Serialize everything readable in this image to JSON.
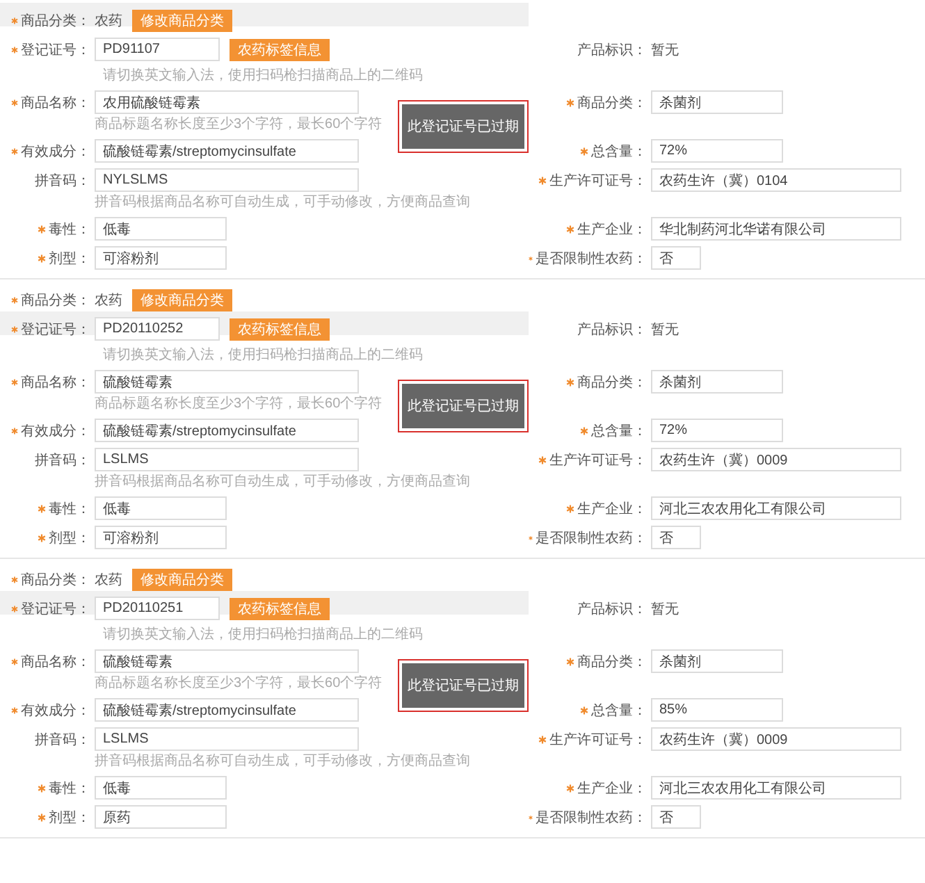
{
  "sections": [
    {
      "category": {
        "label": "商品分类：",
        "required": true,
        "value": "农药",
        "button": "修改商品分类",
        "shaded": true
      },
      "register": {
        "label": "登记证号：",
        "required": true,
        "value": "PD91107",
        "button": "农药标签信息",
        "hint": "请切换英文输入法，使用扫码枪扫描商品上的二维码",
        "shaded": false
      },
      "product_mark": {
        "label": "产品标识：",
        "value": "暂无"
      },
      "notice": "此登记证号已过期",
      "left_fields": [
        {
          "label": "商品名称：",
          "required": true,
          "value": "农用硫酸链霉素",
          "hint": "商品标题名称长度至少3个字符，最长60个字符",
          "kind": "long"
        },
        {
          "label": "有效成分：",
          "required": true,
          "value": "硫酸链霉素/streptomycinsulfate",
          "kind": "long"
        },
        {
          "label": "拼音码：",
          "required": false,
          "value": "NYLSLMS",
          "hint": "拼音码根据商品名称可自动生成，可手动修改，方便商品查询",
          "kind": "long"
        },
        {
          "label": "毒性：",
          "required": true,
          "value": "低毒",
          "kind": "short"
        },
        {
          "label": "剂型：",
          "required": true,
          "value": "可溶粉剂",
          "kind": "short"
        }
      ],
      "right_fields": [
        {
          "label": "商品分类：",
          "required": true,
          "value": "杀菌剂",
          "kind": "short"
        },
        {
          "label": "总含量：",
          "required": true,
          "value": "72%",
          "kind": "short"
        },
        {
          "label": "生产许可证号：",
          "required": true,
          "value": "农药生许（冀）0104",
          "kind": "long"
        },
        {
          "label": "生产企业：",
          "required": true,
          "value": "华北制药河北华诺有限公司",
          "kind": "long"
        },
        {
          "label": "是否限制性农药：",
          "required": true,
          "value": "否",
          "kind": "tiny"
        }
      ]
    },
    {
      "category": {
        "label": "商品分类：",
        "required": true,
        "value": "农药",
        "button": "修改商品分类",
        "shaded": false
      },
      "register": {
        "label": "登记证号：",
        "required": true,
        "value": "PD20110252",
        "button": "农药标签信息",
        "hint": "请切换英文输入法，使用扫码枪扫描商品上的二维码",
        "shaded": true
      },
      "product_mark": {
        "label": "产品标识：",
        "value": "暂无"
      },
      "notice": "此登记证号已过期",
      "left_fields": [
        {
          "label": "商品名称：",
          "required": true,
          "value": "硫酸链霉素",
          "hint": "商品标题名称长度至少3个字符，最长60个字符",
          "kind": "long"
        },
        {
          "label": "有效成分：",
          "required": true,
          "value": "硫酸链霉素/streptomycinsulfate",
          "kind": "long"
        },
        {
          "label": "拼音码：",
          "required": false,
          "value": "LSLMS",
          "hint": "拼音码根据商品名称可自动生成，可手动修改，方便商品查询",
          "kind": "long"
        },
        {
          "label": "毒性：",
          "required": true,
          "value": "低毒",
          "kind": "short"
        },
        {
          "label": "剂型：",
          "required": true,
          "value": "可溶粉剂",
          "kind": "short"
        }
      ],
      "right_fields": [
        {
          "label": "商品分类：",
          "required": true,
          "value": "杀菌剂",
          "kind": "short"
        },
        {
          "label": "总含量：",
          "required": true,
          "value": "72%",
          "kind": "short"
        },
        {
          "label": "生产许可证号：",
          "required": true,
          "value": "农药生许（冀）0009",
          "kind": "long"
        },
        {
          "label": "生产企业：",
          "required": true,
          "value": "河北三农农用化工有限公司",
          "kind": "long"
        },
        {
          "label": "是否限制性农药：",
          "required": true,
          "value": "否",
          "kind": "tiny"
        }
      ]
    },
    {
      "category": {
        "label": "商品分类：",
        "required": true,
        "value": "农药",
        "button": "修改商品分类",
        "shaded": false
      },
      "register": {
        "label": "登记证号：",
        "required": true,
        "value": "PD20110251",
        "button": "农药标签信息",
        "hint": "请切换英文输入法，使用扫码枪扫描商品上的二维码",
        "shaded": true
      },
      "product_mark": {
        "label": "产品标识：",
        "value": "暂无"
      },
      "notice": "此登记证号已过期",
      "left_fields": [
        {
          "label": "商品名称：",
          "required": true,
          "value": "硫酸链霉素",
          "hint": "商品标题名称长度至少3个字符，最长60个字符",
          "kind": "long"
        },
        {
          "label": "有效成分：",
          "required": true,
          "value": "硫酸链霉素/streptomycinsulfate",
          "kind": "long"
        },
        {
          "label": "拼音码：",
          "required": false,
          "value": "LSLMS",
          "hint": "拼音码根据商品名称可自动生成，可手动修改，方便商品查询",
          "kind": "long"
        },
        {
          "label": "毒性：",
          "required": true,
          "value": "低毒",
          "kind": "short"
        },
        {
          "label": "剂型：",
          "required": true,
          "value": "原药",
          "kind": "short"
        }
      ],
      "right_fields": [
        {
          "label": "商品分类：",
          "required": true,
          "value": "杀菌剂",
          "kind": "short"
        },
        {
          "label": "总含量：",
          "required": true,
          "value": "85%",
          "kind": "short"
        },
        {
          "label": "生产许可证号：",
          "required": true,
          "value": "农药生许（冀）0009",
          "kind": "long"
        },
        {
          "label": "生产企业：",
          "required": true,
          "value": "河北三农农用化工有限公司",
          "kind": "long"
        },
        {
          "label": "是否限制性农药：",
          "required": true,
          "value": "否",
          "kind": "tiny"
        }
      ]
    }
  ]
}
